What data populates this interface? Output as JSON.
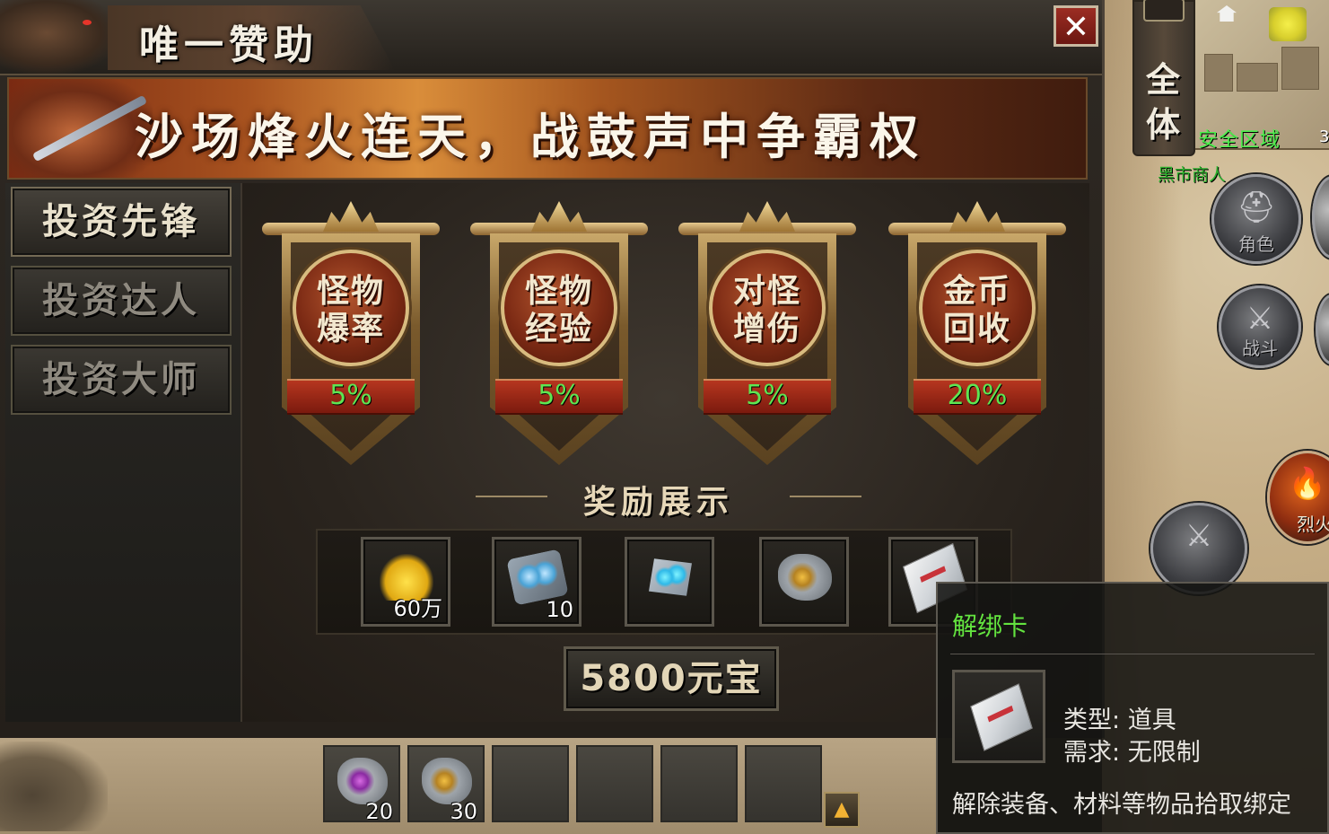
{
  "window": {
    "title": "唯一赞助",
    "close_icon": "close-icon"
  },
  "banner": {
    "text": "沙场烽火连天，战鼓声中争霸权"
  },
  "tabs": [
    {
      "label": "投资先锋",
      "active": true
    },
    {
      "label": "投资达人",
      "active": false
    },
    {
      "label": "投资大师",
      "active": false
    }
  ],
  "bonuses": [
    {
      "line1": "怪物",
      "line2": "爆率",
      "value": "5%"
    },
    {
      "line1": "怪物",
      "line2": "经验",
      "value": "5%"
    },
    {
      "line1": "对怪",
      "line2": "增伤",
      "value": "5%"
    },
    {
      "line1": "金币",
      "line2": "回收",
      "value": "20%"
    }
  ],
  "rewards": {
    "title": "奖励展示",
    "items": [
      {
        "icon": "gold-coins-icon",
        "qty": "60万"
      },
      {
        "icon": "blue-gem-pack-icon",
        "qty": "10"
      },
      {
        "icon": "crystal-shard-icon",
        "qty": ""
      },
      {
        "icon": "gold-scroll-icon",
        "qty": ""
      },
      {
        "icon": "unbind-card-icon",
        "qty": ""
      }
    ],
    "price": "5800元宝"
  },
  "tooltip": {
    "item_name": "解绑卡",
    "type_label": "类型:",
    "type_value": "道具",
    "req_label": "需求:",
    "req_value": "无限制",
    "description": "解除装备、材料等物品拾取绑定"
  },
  "hotbar": [
    {
      "icon": "purple-scroll-icon",
      "qty": "20"
    },
    {
      "icon": "gold-scroll-icon",
      "qty": "30"
    },
    {
      "icon": "",
      "qty": ""
    },
    {
      "icon": "",
      "qty": ""
    },
    {
      "icon": "",
      "qty": ""
    },
    {
      "icon": "",
      "qty": ""
    }
  ],
  "hud": {
    "chat_channel": "全体",
    "safe_zone": "安全区域",
    "coord_fragment": "3",
    "npc_name": "黑市商人",
    "role_button": "角色",
    "battle_button": "战斗",
    "skill_fragment": "烈火"
  },
  "colors": {
    "accent_green": "#5ee652",
    "title_text": "#f3eee2",
    "tooltip_name": "#63e33f"
  }
}
